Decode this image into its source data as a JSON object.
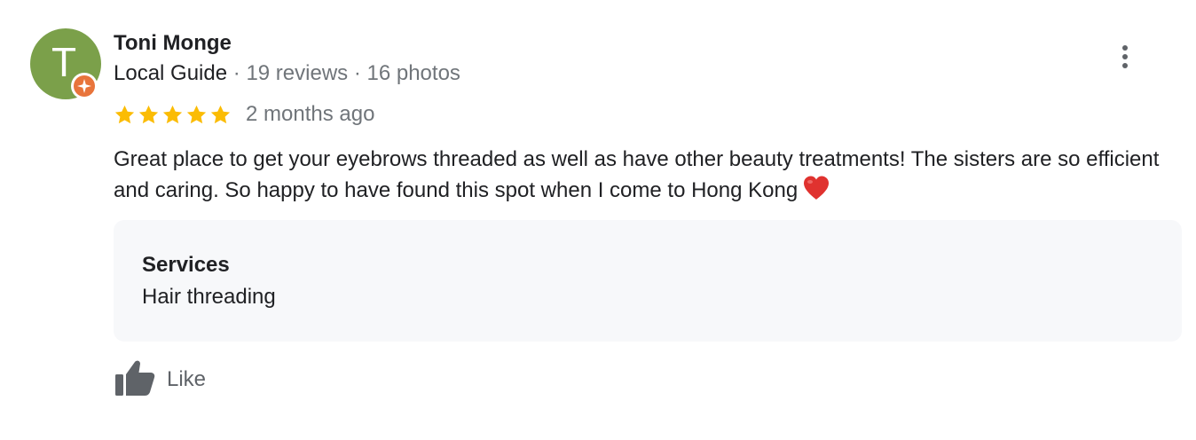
{
  "review": {
    "author": {
      "name": "Toni Monge",
      "avatar_letter": "T",
      "avatar_color": "#7ba04a",
      "badge_icon": "local-guide-badge-icon",
      "badge_color": "#e8743b",
      "guide_label": "Local Guide",
      "separator": "·",
      "reviews": "19 reviews",
      "photos": "16 photos"
    },
    "more_icon": "more-vertical-icon",
    "rating": {
      "stars": 5,
      "max": 5,
      "star_color": "#fbbc04",
      "date": "2 months ago"
    },
    "text": "Great place to get your eyebrows threaded as well as have other beauty treatments! The sisters are so efficient and caring. So happy to have found this spot when I come to Hong Kong",
    "emoji_icon": "red-heart-icon",
    "services": {
      "title": "Services",
      "value": "Hair threading"
    },
    "like": {
      "icon": "thumbs-up-icon",
      "label": "Like",
      "color": "#5f6368"
    }
  }
}
